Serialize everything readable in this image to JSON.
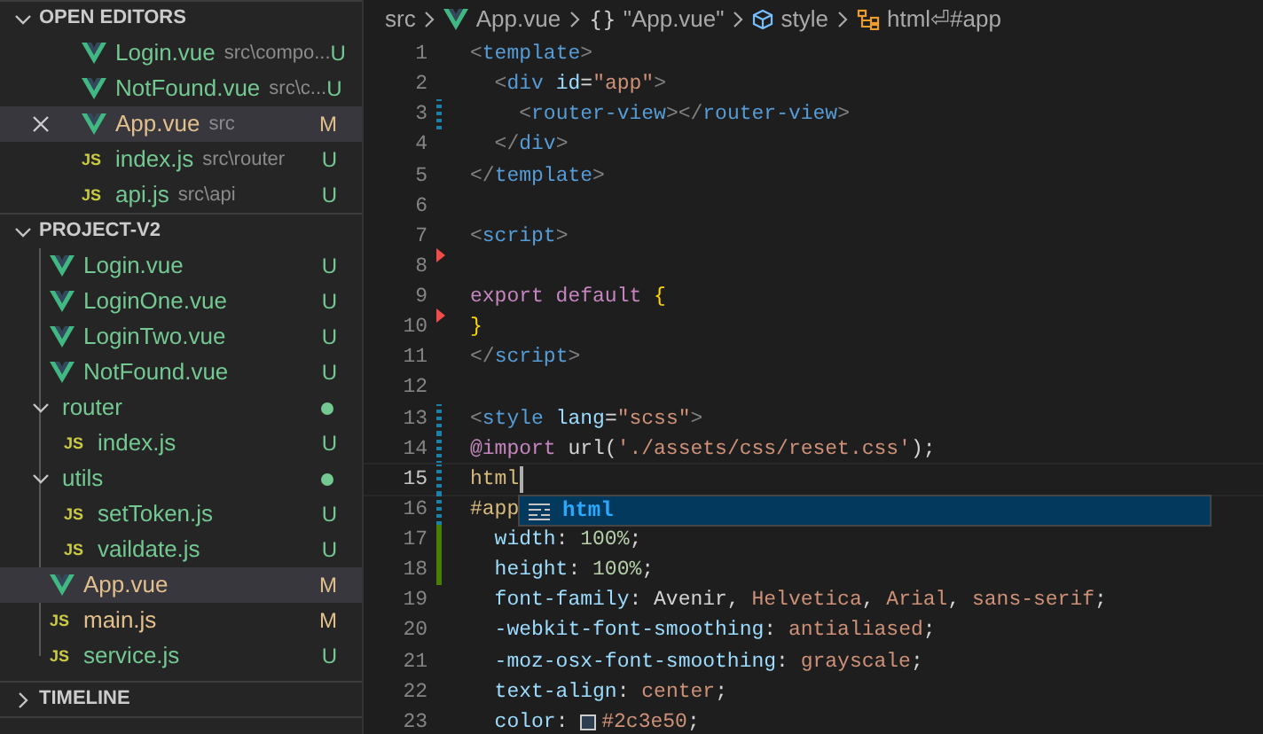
{
  "sidebar": {
    "open_editors": {
      "title": "OPEN EDITORS",
      "expanded": true,
      "items": [
        {
          "kind": "vue",
          "name": "Login.vue",
          "path": "src\\compo...",
          "status": "U",
          "modified": false,
          "selected": false
        },
        {
          "kind": "vue",
          "name": "NotFound.vue",
          "path": "src\\c...",
          "status": "U",
          "modified": false,
          "selected": false
        },
        {
          "kind": "vue",
          "name": "App.vue",
          "path": "src",
          "status": "M",
          "modified": true,
          "selected": true
        },
        {
          "kind": "js",
          "icon_label": "JS",
          "name": "index.js",
          "path": "src\\router",
          "status": "U",
          "modified": false,
          "selected": false
        },
        {
          "kind": "js",
          "icon_label": "JS",
          "name": "api.js",
          "path": "src\\api",
          "status": "U",
          "modified": false,
          "selected": false
        }
      ]
    },
    "project": {
      "title": "PROJECT-V2",
      "expanded": true,
      "tree": [
        {
          "kind": "group",
          "children": [
            {
              "kind": "vue",
              "name": "Login.vue",
              "status": "U",
              "modified": false,
              "selected": false
            },
            {
              "kind": "vue",
              "name": "LoginOne.vue",
              "status": "U",
              "modified": false,
              "selected": false
            },
            {
              "kind": "vue",
              "name": "LoginTwo.vue",
              "status": "U",
              "modified": false,
              "selected": false
            },
            {
              "kind": "vue",
              "name": "NotFound.vue",
              "status": "U",
              "modified": false,
              "selected": false
            }
          ]
        },
        {
          "kind": "folder",
          "name": "router",
          "expanded": true,
          "changes": true,
          "children": [
            {
              "kind": "js",
              "icon_label": "JS",
              "name": "index.js",
              "status": "U",
              "modified": false,
              "selected": false
            }
          ]
        },
        {
          "kind": "folder",
          "name": "utils",
          "expanded": true,
          "changes": true,
          "children": [
            {
              "kind": "js",
              "icon_label": "JS",
              "name": "setToken.js",
              "status": "U",
              "modified": false,
              "selected": false
            },
            {
              "kind": "js",
              "icon_label": "JS",
              "name": "vaildate.js",
              "status": "U",
              "modified": false,
              "selected": false
            }
          ]
        },
        {
          "kind": "vue",
          "name": "App.vue",
          "status": "M",
          "modified": true,
          "selected": true
        },
        {
          "kind": "js",
          "icon_label": "JS",
          "name": "main.js",
          "status": "M",
          "modified": true,
          "selected": false
        },
        {
          "kind": "js",
          "icon_label": "JS",
          "name": "service.js",
          "status": "U",
          "modified": false,
          "selected": false
        }
      ]
    },
    "timeline": {
      "title": "TIMELINE",
      "expanded": false
    }
  },
  "breadcrumb": [
    {
      "kind": "plain",
      "text": "src"
    },
    {
      "kind": "vue",
      "text": "App.vue"
    },
    {
      "kind": "symbol",
      "icon_label": "{}",
      "text": "\"App.vue\""
    },
    {
      "kind": "cube",
      "text": "style"
    },
    {
      "kind": "selector",
      "text": "html⏎#app"
    }
  ],
  "editor": {
    "lines": [
      {
        "number": "1",
        "tokens": [
          {
            "text": "<",
            "kind": "punct"
          },
          {
            "text": "template",
            "kind": "tag"
          },
          {
            "text": ">",
            "kind": "punct"
          }
        ]
      },
      {
        "number": "2",
        "tokens": [
          {
            "text": "  <",
            "kind": "punct"
          },
          {
            "text": "div",
            "kind": "tag"
          },
          {
            "text": " id",
            "kind": "attr"
          },
          {
            "text": "=",
            "kind": "plain"
          },
          {
            "text": "\"app\"",
            "kind": "string"
          },
          {
            "text": ">",
            "kind": "punct"
          }
        ]
      },
      {
        "number": "3",
        "change": {
          "kind": "modified"
        },
        "tokens": [
          {
            "text": "    <",
            "kind": "punct"
          },
          {
            "text": "router-view",
            "kind": "tag"
          },
          {
            "text": "></",
            "kind": "punct"
          },
          {
            "text": "router-view",
            "kind": "tag"
          },
          {
            "text": ">",
            "kind": "punct"
          }
        ]
      },
      {
        "number": "4",
        "tokens": [
          {
            "text": "  </",
            "kind": "punct"
          },
          {
            "text": "div",
            "kind": "tag"
          },
          {
            "text": ">",
            "kind": "punct"
          }
        ]
      },
      {
        "number": "5",
        "tokens": [
          {
            "text": "</",
            "kind": "punct"
          },
          {
            "text": "template",
            "kind": "tag"
          },
          {
            "text": ">",
            "kind": "punct"
          }
        ]
      },
      {
        "number": "6"
      },
      {
        "number": "7",
        "change": {
          "kind": "deleted"
        },
        "tokens": [
          {
            "text": "<",
            "kind": "punct"
          },
          {
            "text": "script",
            "kind": "tag"
          },
          {
            "text": ">",
            "kind": "punct"
          }
        ]
      },
      {
        "number": "8"
      },
      {
        "number": "9",
        "change": {
          "kind": "deleted"
        },
        "tokens": [
          {
            "text": "export default",
            "kind": "keyword"
          },
          {
            "text": " {",
            "kind": "brace"
          }
        ]
      },
      {
        "number": "10",
        "tokens": [
          {
            "text": "}",
            "kind": "brace"
          }
        ]
      },
      {
        "number": "11",
        "tokens": [
          {
            "text": "</",
            "kind": "punct"
          },
          {
            "text": "script",
            "kind": "tag"
          },
          {
            "text": ">",
            "kind": "punct"
          }
        ]
      },
      {
        "number": "12"
      },
      {
        "number": "13",
        "change": {
          "kind": "modified"
        },
        "tokens": [
          {
            "text": "<",
            "kind": "punct"
          },
          {
            "text": "style",
            "kind": "tag"
          },
          {
            "text": " lang",
            "kind": "attr"
          },
          {
            "text": "=",
            "kind": "plain"
          },
          {
            "text": "\"scss\"",
            "kind": "string"
          },
          {
            "text": ">",
            "kind": "punct"
          }
        ]
      },
      {
        "number": "14",
        "change": {
          "kind": "modified"
        },
        "tokens": [
          {
            "text": "@import",
            "kind": "keyword"
          },
          {
            "text": " url(",
            "kind": "plain"
          },
          {
            "text": "'./assets/css/reset.css'",
            "kind": "string"
          },
          {
            "text": ");",
            "kind": "plain"
          }
        ]
      },
      {
        "number": "15",
        "change": {
          "kind": "modified"
        },
        "current": true,
        "tokens": [
          {
            "text": "html",
            "kind": "selector"
          }
        ]
      },
      {
        "number": "16",
        "change": {
          "kind": "modified"
        },
        "tokens": [
          {
            "text": "#app",
            "kind": "selector"
          }
        ]
      },
      {
        "number": "17",
        "change": {
          "kind": "added"
        },
        "tokens": [
          {
            "text": "  width",
            "kind": "attr"
          },
          {
            "text": ": ",
            "kind": "plain"
          },
          {
            "text": "100%",
            "kind": "number"
          },
          {
            "text": ";",
            "kind": "plain"
          }
        ]
      },
      {
        "number": "18",
        "change": {
          "kind": "added"
        },
        "tokens": [
          {
            "text": "  height",
            "kind": "attr"
          },
          {
            "text": ": ",
            "kind": "plain"
          },
          {
            "text": "100%",
            "kind": "number"
          },
          {
            "text": ";",
            "kind": "plain"
          }
        ]
      },
      {
        "number": "19",
        "tokens": [
          {
            "text": "  font-family",
            "kind": "attr"
          },
          {
            "text": ": Avenir, ",
            "kind": "plain"
          },
          {
            "text": "Helvetica",
            "kind": "string"
          },
          {
            "text": ", ",
            "kind": "plain"
          },
          {
            "text": "Arial",
            "kind": "string"
          },
          {
            "text": ", ",
            "kind": "plain"
          },
          {
            "text": "sans-serif",
            "kind": "string"
          },
          {
            "text": ";",
            "kind": "plain"
          }
        ]
      },
      {
        "number": "20",
        "tokens": [
          {
            "text": "  -webkit-font-smoothing",
            "kind": "attr"
          },
          {
            "text": ": ",
            "kind": "plain"
          },
          {
            "text": "antialiased",
            "kind": "string"
          },
          {
            "text": ";",
            "kind": "plain"
          }
        ]
      },
      {
        "number": "21",
        "tokens": [
          {
            "text": "  -moz-osx-font-smoothing",
            "kind": "attr"
          },
          {
            "text": ": ",
            "kind": "plain"
          },
          {
            "text": "grayscale",
            "kind": "string"
          },
          {
            "text": ";",
            "kind": "plain"
          }
        ]
      },
      {
        "number": "22",
        "tokens": [
          {
            "text": "  text-align",
            "kind": "attr"
          },
          {
            "text": ": ",
            "kind": "plain"
          },
          {
            "text": "center",
            "kind": "string"
          },
          {
            "text": ";",
            "kind": "plain"
          }
        ]
      },
      {
        "number": "23",
        "tokens": [
          {
            "text": "  color",
            "kind": "attr"
          },
          {
            "text": ": ",
            "kind": "plain"
          },
          {
            "text": "#2c3e50",
            "kind": "string",
            "color": "#2c3e50"
          },
          {
            "text": ";",
            "kind": "plain"
          }
        ]
      }
    ],
    "suggestions": [
      {
        "label": "html",
        "selected": true
      }
    ]
  }
}
